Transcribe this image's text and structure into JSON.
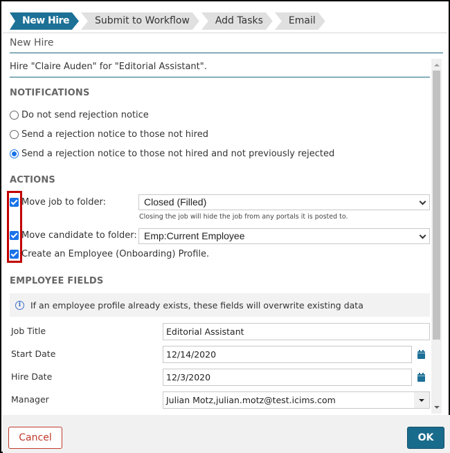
{
  "wizard": {
    "steps": [
      {
        "label": "New Hire",
        "active": true
      },
      {
        "label": "Submit to Workflow",
        "active": false
      },
      {
        "label": "Add Tasks",
        "active": false
      },
      {
        "label": "Email",
        "active": false
      }
    ]
  },
  "page": {
    "heading": "New Hire",
    "summary": "Hire \"Claire Auden\" for \"Editorial Assistant\"."
  },
  "notifications": {
    "title": "NOTIFICATIONS",
    "options": [
      {
        "label": "Do not send rejection notice",
        "checked": false
      },
      {
        "label": "Send a rejection notice to those not hired",
        "checked": false
      },
      {
        "label": "Send a rejection notice to those not hired and not previously rejected",
        "checked": true
      }
    ]
  },
  "actions": {
    "title": "ACTIONS",
    "move_job": {
      "label": "Move job to folder:",
      "checked": true,
      "value": "Closed (Filled)",
      "hint": "Closing the job will hide the job from any portals it is posted to."
    },
    "move_candidate": {
      "label": "Move candidate to folder:",
      "checked": true,
      "value": "Emp:Current Employee"
    },
    "create_profile": {
      "label": "Create an Employee (Onboarding) Profile.",
      "checked": true
    }
  },
  "employee_fields": {
    "title": "EMPLOYEE FIELDS",
    "info": "If an employee profile already exists, these fields will overwrite existing data",
    "job_title": {
      "label": "Job Title",
      "value": "Editorial Assistant"
    },
    "start_date": {
      "label": "Start Date",
      "value": "12/14/2020"
    },
    "hire_date": {
      "label": "Hire Date",
      "value": "12/3/2020"
    },
    "manager": {
      "label": "Manager",
      "value": "Julian Motz,julian.motz@test.icims.com"
    }
  },
  "footer": {
    "cancel": "Cancel",
    "ok": "OK"
  },
  "colors": {
    "accent": "#1d7096",
    "cancel": "#c0392b",
    "highlight": "#c00000"
  }
}
